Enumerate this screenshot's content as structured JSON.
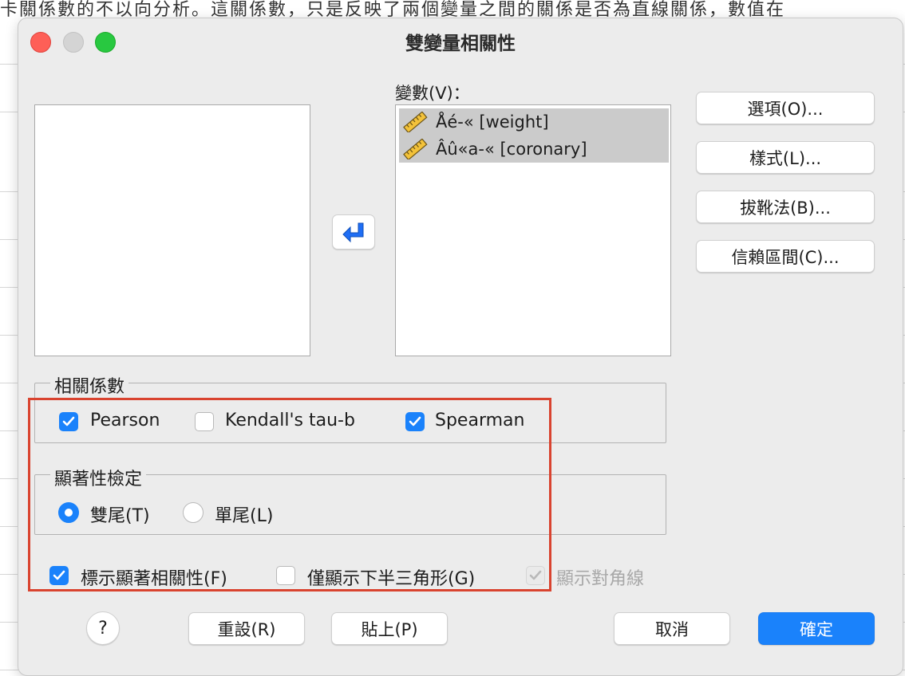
{
  "background": {
    "text_strip": "卡關係數的不以向分析。這關係數，只是反映了兩個變量之間的關係是否為直線關係，數值在"
  },
  "dialog": {
    "title": "雙變量相關性",
    "variables_label": "變數(V)：",
    "variables": [
      {
        "text": "Åé-« [weight]",
        "icon": "ruler-icon"
      },
      {
        "text": "Âû«a-« [coronary]",
        "icon": "ruler-icon"
      }
    ],
    "move_arrow_icon": "arrow-left-icon",
    "side_buttons": {
      "options": "選項(O)...",
      "style": "樣式(L)...",
      "bootstrap": "拔靴法(B)...",
      "confidence": "信賴區間(C)..."
    },
    "correlation": {
      "title": "相關係數",
      "pearson": {
        "label": "Pearson",
        "checked": true
      },
      "kendall": {
        "label": "Kendall's tau-b",
        "checked": false
      },
      "spearman": {
        "label": "Spearman",
        "checked": true
      }
    },
    "significance": {
      "title": "顯著性檢定",
      "two_tailed": {
        "label": "雙尾(T)",
        "selected": true
      },
      "one_tailed": {
        "label": "單尾(L)",
        "selected": false
      }
    },
    "flags": {
      "flag_significant": {
        "label": "標示顯著相關性(F)",
        "checked": true
      },
      "lower_triangle": {
        "label": "僅顯示下半三角形(G)",
        "checked": false
      },
      "show_diagonal": {
        "label": "顯示對角線",
        "checked": true,
        "disabled": true
      }
    },
    "bottom_buttons": {
      "help": "?",
      "reset": "重設(R)",
      "paste": "貼上(P)",
      "cancel": "取消",
      "ok": "確定"
    },
    "colors": {
      "accent": "#1a82fb",
      "annotation": "#d9432f"
    }
  }
}
